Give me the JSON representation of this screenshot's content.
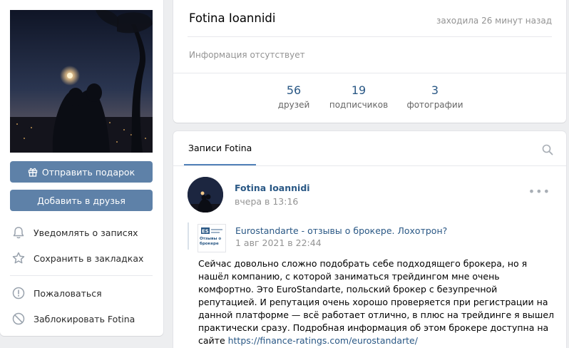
{
  "left": {
    "gift_button": "Отправить подарок",
    "add_friend_button": "Добавить в друзья",
    "actions": [
      {
        "label": "Уведомлять о записях",
        "icon": "bell-icon"
      },
      {
        "label": "Сохранить в закладках",
        "icon": "star-icon"
      },
      {
        "label": "Пожаловаться",
        "icon": "report-icon"
      },
      {
        "label": "Заблокировать Fotina",
        "icon": "block-icon"
      }
    ]
  },
  "profile": {
    "name": "Fotina Ioannidi",
    "last_seen": "заходила 26 минут назад",
    "info": "Информация отсутствует",
    "stats": [
      {
        "count": "56",
        "label": "друзей"
      },
      {
        "count": "19",
        "label": "подписчиков"
      },
      {
        "count": "3",
        "label": "фотографии"
      }
    ]
  },
  "posts": {
    "tab": "Записи Fotina",
    "author": "Fotina Ioannidi",
    "time": "вчера в 13:16",
    "repost": {
      "title": "Eurostandarte - отзывы о брокере. Лохотрон?",
      "date": "1 авг 2021 в 22:44",
      "logo_caption": "Отзывы о брокере",
      "logo_mark": "ES"
    },
    "text": "Сейчас довольно сложно подобрать себе подходящего брокера, но я нашёл компанию, с которой заниматься трейдингом мне очень комфортно. Это EuroStandarte, польский брокер с безупречной репутацией. И репутация очень хорошо проверяется при регистрации на данной платформе — всё работает отлично, в плюс на трейдинге я вышел практически сразу. Подробная информация об этом брокере доступна на сайте ",
    "link": "https://finance-ratings.com/eurostandarte/"
  },
  "colors": {
    "accent": "#5e81a8",
    "link": "#2a5885",
    "muted": "#939393",
    "background": "#edeef0"
  }
}
